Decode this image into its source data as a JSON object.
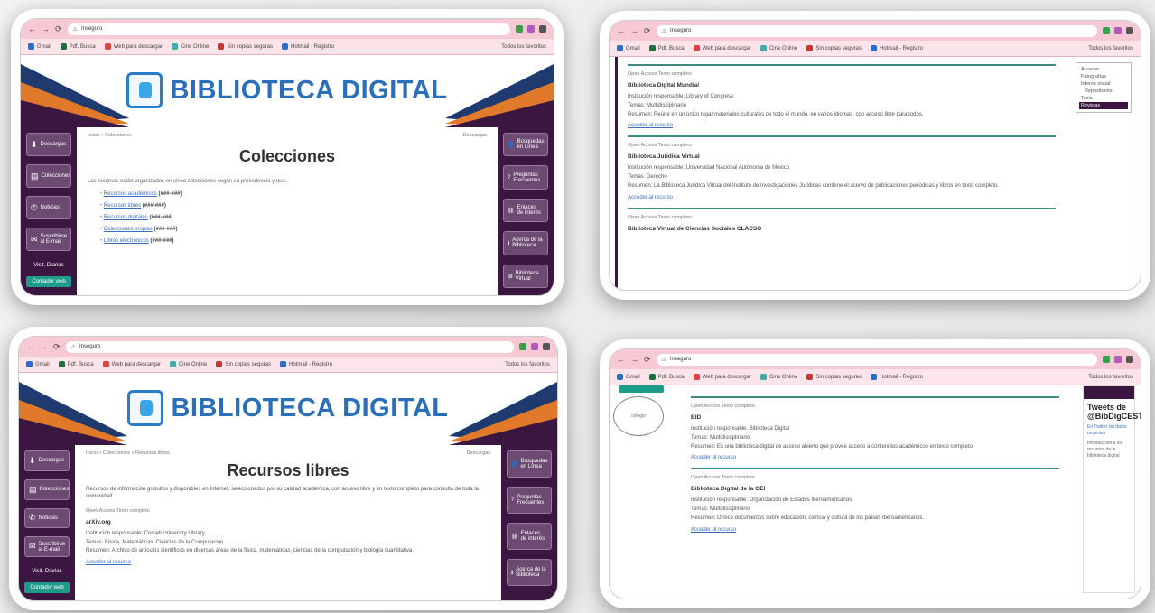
{
  "browser": {
    "url_host": "Inseguro",
    "bookmarks": [
      "Gmail",
      "Pdf. Busca",
      "Web para descargar",
      "Cine Online",
      "Sin copias seguras",
      "Hotmail - Registro",
      "Todos los favoritos"
    ]
  },
  "site": {
    "brand": "BIBLIOTECA DIGITAL"
  },
  "sidebar_left": [
    "Descargas",
    "Colecciones",
    "Noticias",
    "Suscribirse al E-mail"
  ],
  "sidebar_left_footer": "Visit. Diarias",
  "sidebar_left_green": "Contador web",
  "sidebar_right": [
    "Búsquedas en Línea",
    "Preguntas Frecuentes",
    "Enlaces de interés",
    "Acerca de la Biblioteca",
    "Biblioteca Virtual"
  ],
  "shot1": {
    "crumb": "Inicio » Colecciones",
    "right_link": "Descargas",
    "title": "Colecciones",
    "intro": "Los recursos están organizados en cinco colecciones según su procedencia y uso:",
    "links": [
      {
        "text": "Recursos académicos",
        "count": "(###-###)"
      },
      {
        "text": "Recursos libres",
        "count": "(###-###)"
      },
      {
        "text": "Recursos digitales",
        "count": "(###-###)"
      },
      {
        "text": "Colecciones propias",
        "count": "(###-###)"
      },
      {
        "text": "Libros electrónicos",
        "count": "(###-###)"
      }
    ]
  },
  "shot2": {
    "dropdown": [
      "Acceder",
      "Fotografías",
      "Interés social",
      "Repositorios",
      "Tesis",
      "Revistas"
    ],
    "blocks": [
      {
        "tags": "Open Access  Texto completo",
        "title": "Biblioteca Digital Mundial",
        "inst": "Institución responsable: Library of Congress",
        "tema": "Temas: Multidisciplinario",
        "resumen": "Resumen: Reúne en un único lugar materiales culturales de todo el mundo, en varios idiomas, con acceso libre para todos.",
        "link": "Acceder al recurso"
      },
      {
        "tags": "Open Access  Texto completo",
        "title": "Biblioteca Juridica Virtual",
        "inst": "Institución responsable: Universidad Nacional Autónoma de México",
        "tema": "Temas: Derecho",
        "resumen": "Resumen: La Biblioteca Jurídica Virtual del Instituto de Investigaciones Jurídicas contiene el acervo de publicaciones periódicas y libros en texto completo.",
        "link": "Acceder al recurso"
      },
      {
        "tags": "Open Access  Texto completo",
        "title": "Biblioteca Virtual de Ciencias Sociales CLACSO",
        "inst": "",
        "tema": "",
        "resumen": "",
        "link": ""
      }
    ]
  },
  "shot3": {
    "crumb": "Inicio » Colecciones » Recursos libres",
    "right_link": "Descargas",
    "title": "Recursos libres",
    "desc": "Recursos de información gratuitos y disponibles en Internet, seleccionados por su calidad académica, con acceso libre y en texto completo para consulta de toda la comunidad.",
    "tags": "Open Access  Texto completo",
    "block_title": "arXiv.org",
    "inst": "Institución responsable: Cornell University Library",
    "tema": "Temas: Física, Matemáticas, Ciencias de la Computación",
    "resumen": "Resumen: Archivo de artículos científicos en diversas áreas de la física, matemáticas, ciencias de la computación y biología cuantitativa.",
    "link": "Acceder al recurso"
  },
  "shot4": {
    "colegio": "colegio",
    "tweets_title": "Tweets de @BibDigCEST",
    "tweets_link": "En Twitter sin datos recientes",
    "tweets_text": "Introducción a los recursos de la biblioteca digital",
    "blocks": [
      {
        "tags": "Open Access  Texto completo",
        "title": "BID",
        "inst": "Institución responsable: Biblioteca Digital",
        "tema": "Temas: Multidisciplinario",
        "resumen": "Resumen: Es una biblioteca digital de acceso abierto que provee acceso a contenidos académicos en texto completo.",
        "link": "Acceder al recurso"
      },
      {
        "tags": "Open Access  Texto completo",
        "title": "Biblioteca Digital de la OEI",
        "inst": "Institución responsable: Organización de Estados Iberoamericanos",
        "tema": "Temas: Multidisciplinario",
        "resumen": "Resumen: Ofrece documentos sobre educación, ciencia y cultura de los países iberoamericanos.",
        "link": "Acceder al recurso"
      }
    ]
  }
}
